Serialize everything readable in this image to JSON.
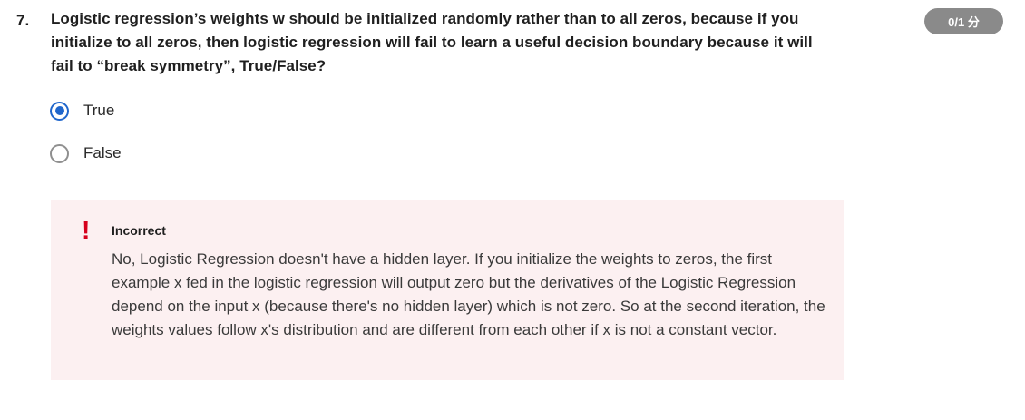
{
  "question": {
    "number": "7.",
    "text": "Logistic regression’s weights w should be initialized randomly rather than to all zeros, because if you initialize to all zeros, then logistic regression will fail to learn a useful decision boundary because it will fail to “break symmetry”, True/False?",
    "score": "0/1 分"
  },
  "options": [
    {
      "label": "True",
      "selected": true
    },
    {
      "label": "False",
      "selected": false
    }
  ],
  "feedback": {
    "icon": "!",
    "icon_name": "exclamation-icon",
    "status": "Incorrect",
    "text": "No, Logistic Regression doesn't have a hidden layer. If you initialize the weights to zeros, the first example x fed in the logistic regression will output zero but the derivatives of the Logistic Regression depend on the input x (because there's no hidden layer) which is not zero. So at the second iteration, the weights values follow x's distribution and are different from each other if x is not a constant vector."
  },
  "colors": {
    "accent": "#1f66cc",
    "error": "#d6001c",
    "feedback_bg": "#fcf0f1",
    "badge_bg": "#8a8a8a"
  }
}
